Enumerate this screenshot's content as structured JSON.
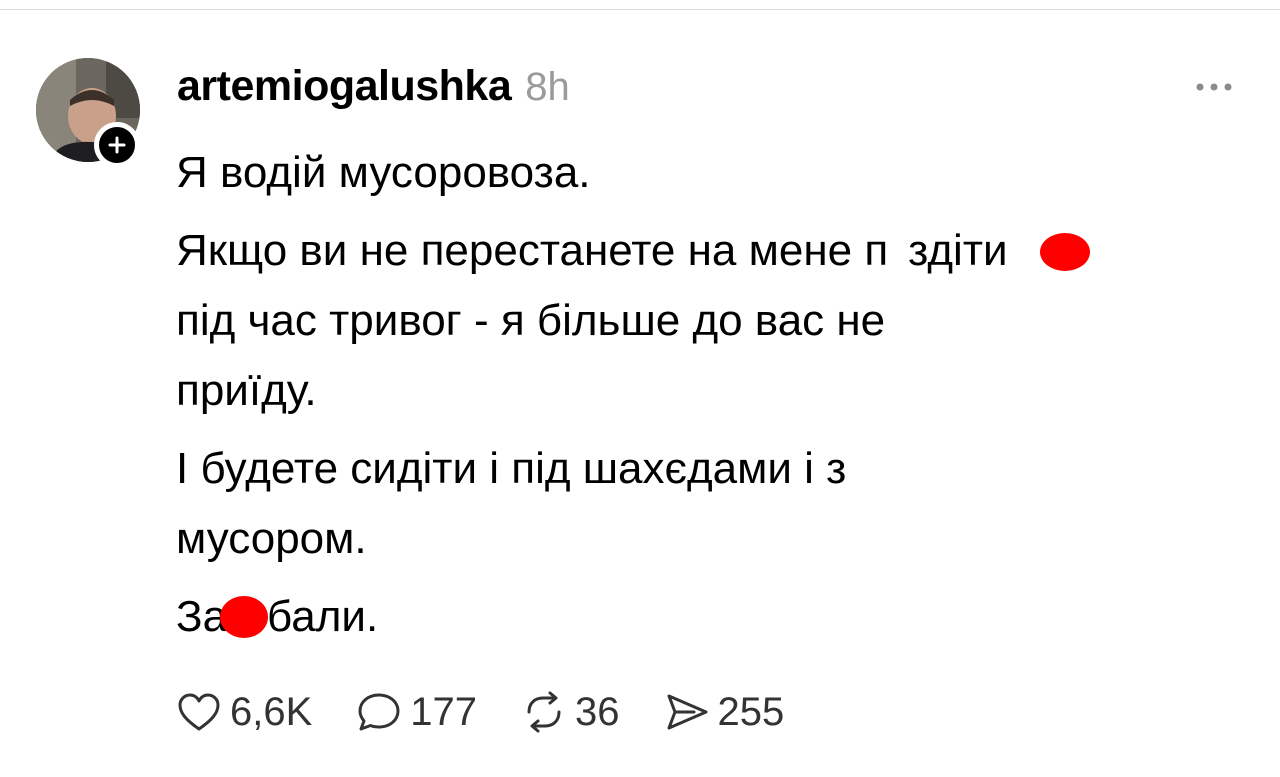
{
  "post": {
    "username": "artemiogalushka",
    "timestamp": "8h",
    "lines": [
      {
        "a": "Я водій мусоровоза.",
        "b": ""
      },
      {
        "a": "Якщо ви не перестанете на мене п",
        "b": "здіти"
      },
      {
        "a": "під час тривог - я більше до вас не",
        "b": ""
      },
      {
        "a": "приїду.",
        "b": ""
      },
      {
        "a": "І будете сидіти і під шахєдами і з",
        "b": ""
      },
      {
        "a": "мусором.",
        "b": ""
      },
      {
        "a": "За",
        "b": "бали."
      }
    ]
  },
  "actions": {
    "likes": "6,6K",
    "replies": "177",
    "reposts": "36",
    "shares": "255"
  },
  "icons": {
    "like": "heart-icon",
    "reply": "speech-bubble-icon",
    "repost": "repost-arrows-icon",
    "share": "send-icon",
    "more": "more-dots-icon",
    "follow": "plus-icon"
  },
  "colors": {
    "censor": "#ff0000",
    "timestamp": "#9a9a9a",
    "text": "#000000"
  }
}
